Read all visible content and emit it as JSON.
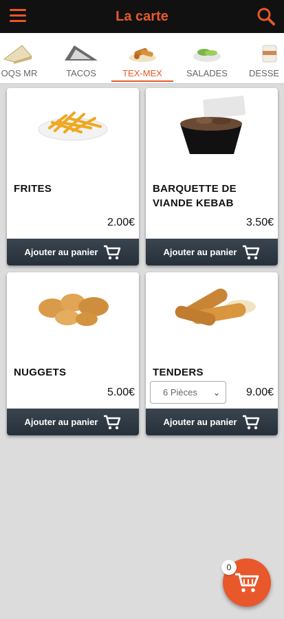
{
  "header": {
    "title": "La carte",
    "menu_icon": "hamburger-icon",
    "search_icon": "search-icon"
  },
  "categories": [
    {
      "label": "OQS MR"
    },
    {
      "label": "TACOS"
    },
    {
      "label": "TEX-MEX",
      "active": true
    },
    {
      "label": "SALADES"
    },
    {
      "label": "DESSE"
    }
  ],
  "products": [
    {
      "name": "FRITES",
      "price": "2.00€",
      "add_label": "Ajouter au panier"
    },
    {
      "name": "BARQUETTE DE VIANDE KEBAB",
      "price": "3.50€",
      "add_label": "Ajouter au panier"
    },
    {
      "name": "NUGGETS",
      "price": "5.00€",
      "add_label": "Ajouter au panier"
    },
    {
      "name": "TENDERS",
      "price": "9.00€",
      "add_label": "Ajouter au panier",
      "option": "6 Pièces"
    }
  ],
  "cart": {
    "count": "0"
  },
  "colors": {
    "accent": "#e8582a",
    "header_bg": "#111111",
    "button_bg": "#2f3a45"
  }
}
